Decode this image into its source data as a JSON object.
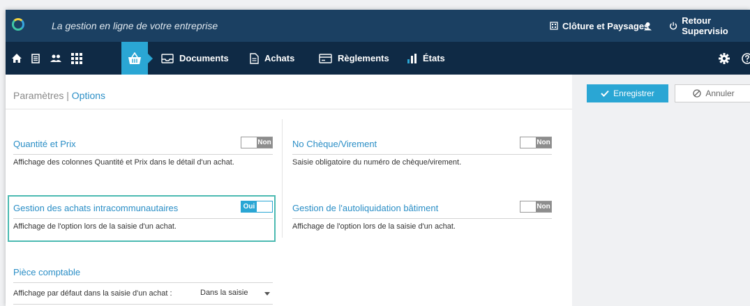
{
  "header": {
    "tagline": "La gestion en ligne de votre entreprise",
    "company": "Clôture et Paysages",
    "supervision": "Retour Supervisio"
  },
  "nav": {
    "items": [
      {
        "label": "Documents"
      },
      {
        "label": "Achats"
      },
      {
        "label": "Règlements"
      },
      {
        "label": "États"
      }
    ]
  },
  "breadcrumb": {
    "parent": "Paramètres",
    "separator": "|",
    "current": "Options"
  },
  "options": [
    {
      "title": "Quantité et Prix",
      "toggle": "Non",
      "description": "Affichage des colonnes Quantité et Prix dans le détail d'un achat."
    },
    {
      "title": "No Chèque/Virement",
      "toggle": "Non",
      "description": "Saisie obligatoire du numéro de chèque/virement."
    },
    {
      "title": "Gestion des achats intracommunautaires",
      "toggle": "Oui",
      "description": "Affichage de l'option lors de la saisie d'un achat."
    },
    {
      "title": "Gestion de l'autoliquidation bâtiment",
      "toggle": "Non",
      "description": "Affichage de l'option lors de la saisie d'un achat."
    }
  ],
  "piece": {
    "title": "Pièce comptable",
    "label": "Affichage par défaut dans la saisie d'un achat :",
    "value": "Dans la saisie"
  },
  "actions": {
    "save": "Enregistrer",
    "cancel": "Annuler"
  },
  "colors": {
    "header": "#1b4062",
    "nav": "#0f2a45",
    "accent": "#2aa6d4",
    "highlight": "#4bbab1"
  }
}
